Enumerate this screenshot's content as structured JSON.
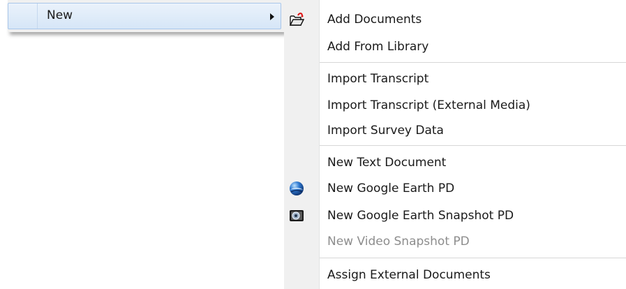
{
  "parent_menu": {
    "item_label": "New"
  },
  "submenu": {
    "items": [
      {
        "label": "Add Documents",
        "icon": "open-folder-icon",
        "enabled": true
      },
      {
        "label": "Add From Library",
        "enabled": true
      },
      {
        "label": "Import Transcript",
        "enabled": true
      },
      {
        "label": "Import Transcript (External Media)",
        "enabled": true
      },
      {
        "label": "Import Survey Data",
        "enabled": true
      },
      {
        "label": "New Text Document",
        "enabled": true
      },
      {
        "label": "New Google Earth PD",
        "icon": "google-earth-icon",
        "enabled": true
      },
      {
        "label": "New Google Earth Snapshot PD",
        "icon": "snapshot-camera-icon",
        "enabled": true
      },
      {
        "label": "New Video Snapshot PD",
        "enabled": false
      },
      {
        "label": "Assign External Documents",
        "enabled": true
      }
    ]
  },
  "colors": {
    "highlight_fill": "#d6e6f7",
    "highlight_border": "#a9c6ea",
    "gutter": "#f0f0f0",
    "disabled_text": "#8d8d8d"
  }
}
